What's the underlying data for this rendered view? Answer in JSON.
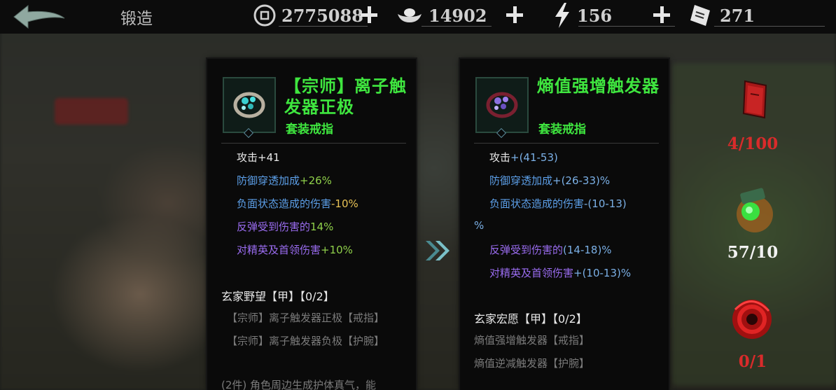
{
  "header": {
    "title": "锻造",
    "resources": [
      {
        "icon": "coin-icon",
        "value": "2775088"
      },
      {
        "icon": "silver-ingot-icon",
        "value": "14902"
      },
      {
        "icon": "energy-bolt-icon",
        "value": "156"
      },
      {
        "icon": "ticket-icon",
        "value": "271"
      }
    ]
  },
  "left_item": {
    "name": "【宗师】离子触发器正极",
    "type": "套装戒指",
    "stats": [
      {
        "label": "攻击",
        "value": "+41"
      },
      {
        "label": "防御穿透加成",
        "value": "+26%"
      },
      {
        "label": "负面状态造成的伤害",
        "value": "-10%"
      },
      {
        "label": "反弹受到伤害的",
        "value": "14%"
      },
      {
        "label": "对精英及首领伤害",
        "value": "+10%"
      }
    ],
    "set_title": "玄家野望【甲】【0/2】",
    "set_items": [
      "【宗师】离子触发器正极【戒指】",
      "【宗师】离子触发器负极【护腕】"
    ],
    "set_bonus": "(2件) 角色周边生成护体真气，能"
  },
  "right_item": {
    "name": "熵值强增触发器",
    "type": "套装戒指",
    "stats": [
      {
        "label": "攻击",
        "value": "+(41-53)"
      },
      {
        "label": "防御穿透加成",
        "value": "+(26-33)%"
      },
      {
        "label": "负面状态造成的伤害",
        "value": "-(10-13)"
      },
      {
        "label": "",
        "value": "%"
      },
      {
        "label": "反弹受到伤害的",
        "value": "(14-18)%"
      },
      {
        "label": "对精英及首领伤害",
        "value": "+(10-13)%"
      }
    ],
    "set_title": "玄家宏愿【甲】【0/2】",
    "set_items": [
      "熵值强增触发器【戒指】",
      "熵值逆减触发器【护腕】"
    ]
  },
  "materials": [
    {
      "icon": "red-book-icon",
      "count": "4/100",
      "color": "#d92b2b"
    },
    {
      "icon": "green-orb-icon",
      "count": "57/10",
      "color": "#f2f2f2"
    },
    {
      "icon": "red-swirl-icon",
      "count": "0/1",
      "color": "#d92b2b"
    }
  ]
}
